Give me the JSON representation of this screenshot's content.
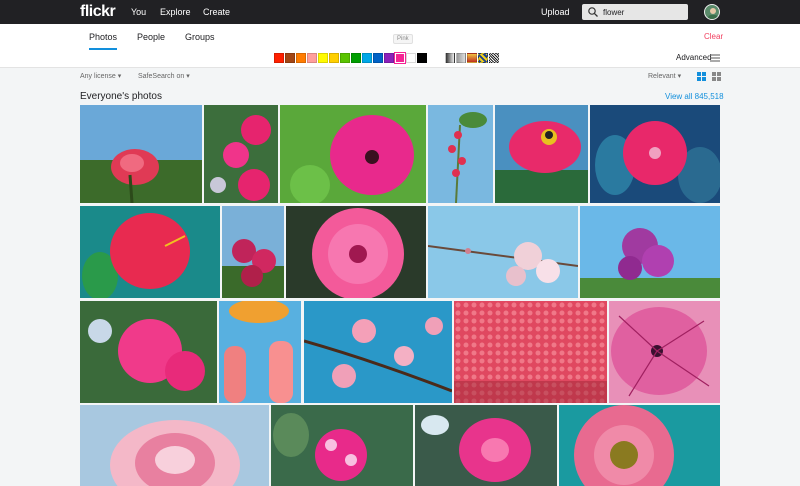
{
  "nav": {
    "logo": "flickr",
    "links": [
      "You",
      "Explore",
      "Create"
    ],
    "upload": "Upload",
    "search_value": "flower"
  },
  "tabs": {
    "items": [
      "Photos",
      "People",
      "Groups"
    ],
    "active": "Photos",
    "clear": "Clear",
    "advanced": "Advanced",
    "tooltip": "Pink"
  },
  "colors": {
    "swatches": [
      "#ff2000",
      "#a24615",
      "#ff7c00",
      "#ff9f9c",
      "#fffa00",
      "#ffcf00",
      "#5ac300",
      "#009e00",
      "#00c8ff",
      "#0062c6",
      "#8c20ba",
      "#f52394",
      "#ffffff",
      "#000000"
    ],
    "selected": "#f52394",
    "accent": "#128fdc",
    "clear_color": "#f13f5f"
  },
  "filters": {
    "license": "Any license",
    "safesearch": "SafeSearch on",
    "sort": "Relevant"
  },
  "section": {
    "title": "Everyone's photos",
    "view_all": "View all 845,518"
  }
}
